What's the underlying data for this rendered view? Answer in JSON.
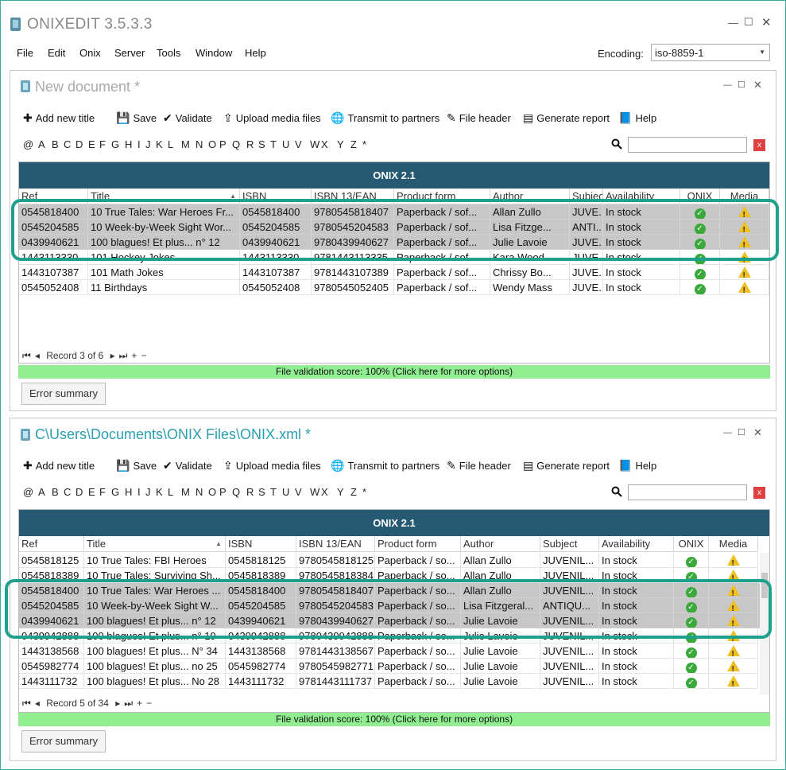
{
  "app": {
    "title": "ONIXEDIT 3.5.3.3",
    "menu": [
      "File",
      "Edit",
      "Onix",
      "Server",
      "Tools",
      "Window",
      "Help"
    ],
    "encoding_label": "Encoding:",
    "encoding_value": "iso-8859-1"
  },
  "toolbar": {
    "add": "Add new title",
    "save": "Save",
    "validate": "Validate",
    "upload": "Upload media files",
    "transmit": "Transmit to partners",
    "header": "File header",
    "report": "Generate report",
    "help": "Help"
  },
  "alphabet": [
    "@",
    "A",
    "B",
    "C",
    "D",
    "E",
    "F",
    "G",
    "H",
    "I",
    "J",
    "K",
    "L",
    "M",
    "N",
    "O",
    "P",
    "Q",
    "R",
    "S",
    "T",
    "U",
    "V",
    "W",
    "X",
    "Y",
    "Z",
    "*"
  ],
  "clear_label": "x",
  "columns": [
    "Ref",
    "Title",
    "ISBN",
    "ISBN 13/EAN",
    "Product form",
    "Author",
    "Subject",
    "Availability",
    "ONIX",
    "Media"
  ],
  "doc1": {
    "title": "New document *",
    "grid_title": "ONIX 2.1",
    "pager": "Record 3 of 6",
    "validation": "File validation score: 100%      (Click here for more options)",
    "error_button": "Error summary",
    "rows": [
      [
        "0545818400",
        "10 True Tales: War Heroes Fr...",
        "0545818400",
        "9780545818407",
        "Paperback / sof...",
        "Allan Zullo",
        "JUVE...",
        "In stock"
      ],
      [
        "0545204585",
        "10 Week-by-Week Sight Wor...",
        "0545204585",
        "9780545204583",
        "Paperback / sof...",
        "Lisa Fitzge...",
        "ANTI...",
        "In stock"
      ],
      [
        "0439940621",
        "100 blagues! Et plus... n° 12",
        "0439940621",
        "9780439940627",
        "Paperback / sof...",
        "Julie Lavoie",
        "JUVE...",
        "In stock"
      ],
      [
        "1443113330",
        "101 Hockey Jokes",
        "1443113330",
        "9781443113335",
        "Paperback / sof...",
        "Kara Wood...",
        "JUVE...",
        "In stock"
      ],
      [
        "1443107387",
        "101 Math Jokes",
        "1443107387",
        "9781443107389",
        "Paperback / sof...",
        "Chrissy Bo...",
        "JUVE...",
        "In stock"
      ],
      [
        "0545052408",
        "11 Birthdays",
        "0545052408",
        "9780545052405",
        "Paperback / sof...",
        "Wendy Mass",
        "JUVE...",
        "In stock"
      ]
    ]
  },
  "doc2": {
    "title": "C\\Users\\Documents\\ONIX Files\\ONIX.xml *",
    "grid_title": "ONIX 2.1",
    "pager": "Record 5 of 34",
    "validation": "File validation score: 100%      (Click here for more options)",
    "error_button": "Error summary",
    "rows": [
      [
        "0545818125",
        "10 True Tales: FBI Heroes",
        "0545818125",
        "9780545818125",
        "Paperback / so...",
        "Allan Zullo",
        "JUVENIL...",
        "In stock"
      ],
      [
        "0545818389",
        "10 True Tales: Surviving Sh...",
        "0545818389",
        "9780545818384",
        "Paperback / so...",
        "Allan Zullo",
        "JUVENIL...",
        "In stock"
      ],
      [
        "0545818400",
        "10 True Tales: War Heroes ...",
        "0545818400",
        "9780545818407",
        "Paperback / so...",
        "Allan Zullo",
        "JUVENIL...",
        "In stock"
      ],
      [
        "0545204585",
        "10 Week-by-Week Sight W...",
        "0545204585",
        "9780545204583",
        "Paperback / so...",
        "Lisa Fitzgeral...",
        "ANTIQU...",
        "In stock"
      ],
      [
        "0439940621",
        "100 blagues! Et plus... n° 12",
        "0439940621",
        "9780439940627",
        "Paperback / so...",
        "Julie Lavoie",
        "JUVENIL...",
        "In stock"
      ],
      [
        "0439942888",
        "100 blagues! Et plus... n° 19",
        "0439942888",
        "9780439942888",
        "Paperback / so...",
        "Julie Lavoie",
        "JUVENIL...",
        "In stock"
      ],
      [
        "1443138568",
        "100 blagues! Et plus... N° 34",
        "1443138568",
        "9781443138567",
        "Paperback / so...",
        "Julie Lavoie",
        "JUVENIL...",
        "In stock"
      ],
      [
        "0545982774",
        "100 blagues! Et plus... no 25",
        "0545982774",
        "9780545982771",
        "Paperback / so...",
        "Julie Lavoie",
        "JUVENIL...",
        "In stock"
      ],
      [
        "1443111732",
        "100 blagues! Et plus... No 28",
        "1443111732",
        "9781443111737",
        "Paperback / so...",
        "Julie Lavoie",
        "JUVENIL...",
        "In stock"
      ]
    ]
  }
}
